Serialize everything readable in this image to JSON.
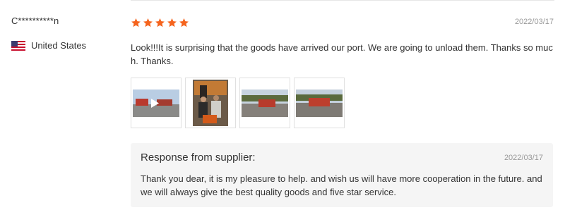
{
  "review": {
    "reviewer_name": "C**********n",
    "country": "United States",
    "country_flag_icon": "us-flag-icon",
    "rating": 5,
    "rating_max": 5,
    "star_color": "#f5641e",
    "date": "2022/03/17",
    "text": "Look!!!It is surprising that the goods have arrived our port. We are going to unload them. Thanks so much. Thanks.",
    "thumbnails": [
      {
        "kind": "video",
        "icon": "play-icon"
      },
      {
        "kind": "photo"
      },
      {
        "kind": "photo"
      },
      {
        "kind": "photo"
      }
    ]
  },
  "supplier_response": {
    "title": "Response from supplier:",
    "date": "2022/03/17",
    "text": "Thank you dear, it is my pleasure to help. and wish us will have more cooperation in the future. and we will always give the best quality goods and five star service."
  }
}
